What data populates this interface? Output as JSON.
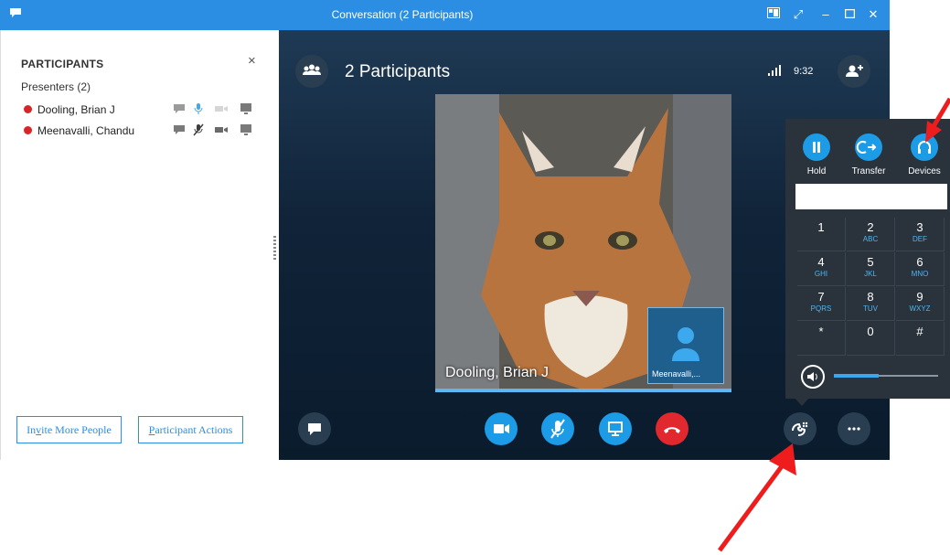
{
  "window": {
    "title": "Conversation (2 Participants)"
  },
  "participants_pane": {
    "header": "PARTICIPANTS",
    "close_glyph": "×",
    "group_label": "Presenters (2)",
    "participants": [
      {
        "name": "Dooling, Brian J",
        "status_color": "#d9252a"
      },
      {
        "name": "Meenavalli, Chandu",
        "status_color": "#d9252a"
      }
    ],
    "buttons": {
      "invite_prefix": "In",
      "invite_underline": "v",
      "invite_rest": "ite More People",
      "actions_underline": "P",
      "actions_rest": "articipant Actions"
    }
  },
  "stage": {
    "title": "2 Participants",
    "clock": "9:32",
    "video_caption": "Dooling, Brian J",
    "self_caption": "Meenavalli,..."
  },
  "dial_pad": {
    "options": [
      "Hold",
      "Transfer",
      "Devices"
    ],
    "keys": [
      {
        "digit": "1",
        "letters": ""
      },
      {
        "digit": "2",
        "letters": "ABC"
      },
      {
        "digit": "3",
        "letters": "DEF"
      },
      {
        "digit": "4",
        "letters": "GHI"
      },
      {
        "digit": "5",
        "letters": "JKL"
      },
      {
        "digit": "6",
        "letters": "MNO"
      },
      {
        "digit": "7",
        "letters": "PQRS"
      },
      {
        "digit": "8",
        "letters": "TUV"
      },
      {
        "digit": "9",
        "letters": "WXYZ"
      },
      {
        "digit": "*",
        "letters": ""
      },
      {
        "digit": "0",
        "letters": ""
      },
      {
        "digit": "#",
        "letters": ""
      }
    ],
    "volume_level": 0.43
  },
  "colors": {
    "accent": "#2b8ee3",
    "call_button": "#1c9be6",
    "hangup": "#e0282e",
    "annotation_arrow": "#ee1c1c"
  }
}
